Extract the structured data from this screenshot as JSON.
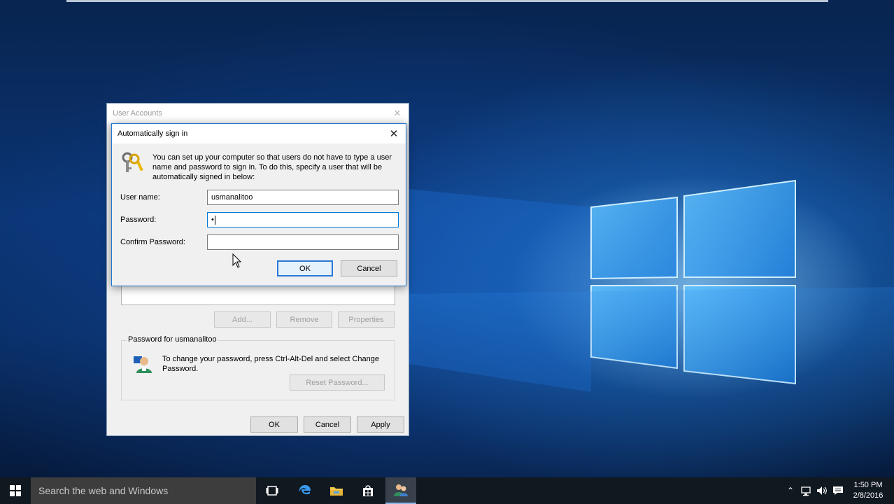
{
  "user_accounts": {
    "title": "User Accounts",
    "buttons": {
      "add": "Add...",
      "remove": "Remove",
      "properties": "Properties"
    },
    "password_group": {
      "label": "Password for usmanalitoo",
      "text": "To change your password, press Ctrl-Alt-Del and select Change Password.",
      "reset_button": "Reset Password..."
    },
    "footer": {
      "ok": "OK",
      "cancel": "Cancel",
      "apply": "Apply"
    }
  },
  "auto_signin": {
    "title": "Automatically sign in",
    "description": "You can set up your computer so that users do not have to type a user name and password to sign in. To do this, specify a user that will be automatically signed in below:",
    "fields": {
      "username_label": "User name:",
      "username_value": "usmanalitoo",
      "password_label": "Password:",
      "password_value": "•",
      "confirm_label": "Confirm Password:",
      "confirm_value": ""
    },
    "ok": "OK",
    "cancel": "Cancel"
  },
  "taskbar": {
    "search_placeholder": "Search the web and Windows",
    "apps": [
      "task-view-icon",
      "edge-icon",
      "file-explorer-icon",
      "store-icon",
      "user-accounts-icon"
    ],
    "clock": {
      "time": "1:50 PM",
      "date": "2/8/2016"
    }
  },
  "colors": {
    "accent": "#0078d7",
    "taskbar": "#101820",
    "search_box": "#3d3d3d"
  }
}
